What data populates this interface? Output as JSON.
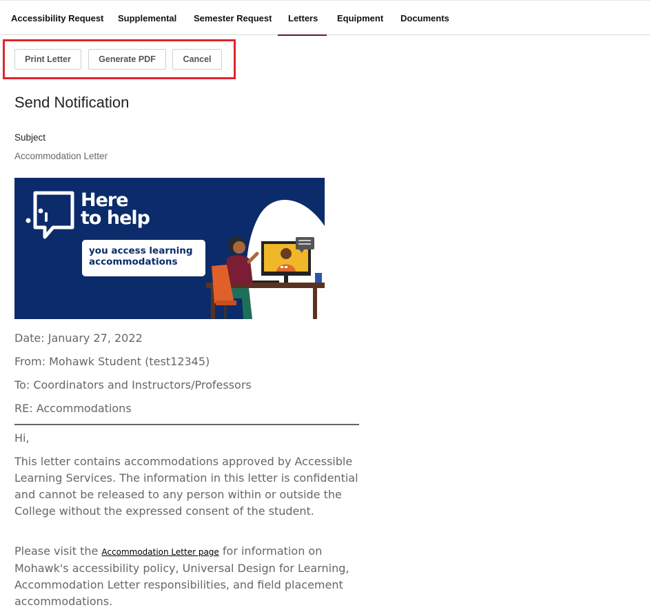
{
  "tabs": [
    {
      "label": "Accessibility Request"
    },
    {
      "label": "Supplemental"
    },
    {
      "label": "Semester Request"
    },
    {
      "label": "Letters",
      "active": true
    },
    {
      "label": "Equipment"
    },
    {
      "label": "Documents"
    }
  ],
  "actions": {
    "print_label": "Print Letter",
    "pdf_label": "Generate PDF",
    "cancel_label": "Cancel"
  },
  "notification": {
    "heading": "Send Notification",
    "subject_label": "Subject",
    "subject_value": "Accommodation Letter"
  },
  "banner": {
    "title_line1": "Here",
    "title_line2": "to help",
    "pill_text": "you access learning accommodations"
  },
  "letter": {
    "date": "Date: January 27, 2022",
    "from": "From: Mohawk Student (test12345)",
    "to": "To: Coordinators and Instructors/Professors",
    "re": "RE: Accommodations",
    "greeting": "Hi,",
    "body1": "This letter contains accommodations approved by Accessible Learning Services. The information in this letter is confidential and cannot be released to any person within or outside the College without the expressed consent of the student.",
    "body2_pre": "Please visit the ",
    "body2_link": "Accommodation Letter page",
    "body2_post": " for information on Mohawk's accessibility policy, Universal Design for Learning, Accommodation Letter responsibilities, and field placement accommodations."
  },
  "colors": {
    "active_tab_underline": "#5a1a30",
    "highlight_box": "#e0242b",
    "banner_bg": "#0b2b6b"
  }
}
